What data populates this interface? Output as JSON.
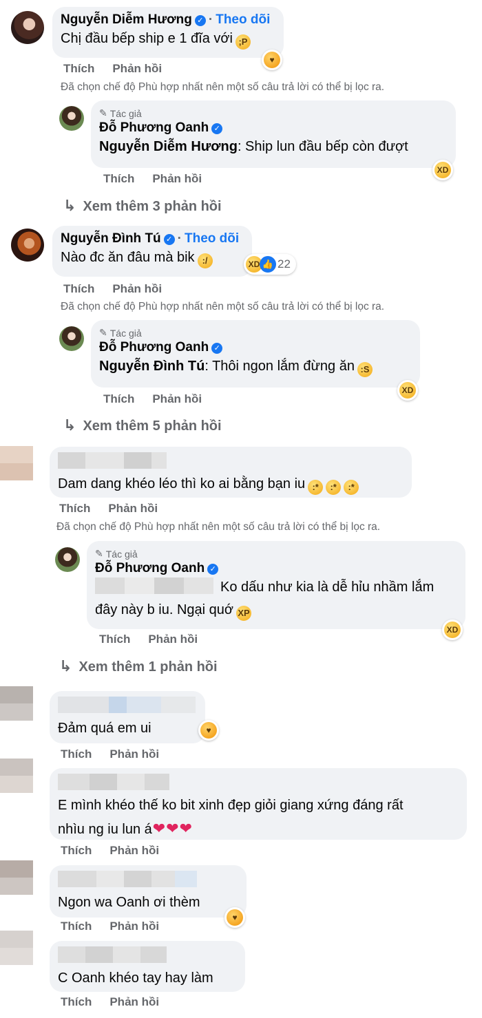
{
  "labels": {
    "like": "Thích",
    "reply": "Phản hồi",
    "follow": "Theo dõi",
    "author_badge": "Tác giả",
    "filter_note": "Đã chọn chế độ Phù hợp nhất nên một số câu trả lời có thể bị lọc ra."
  },
  "threads": [
    {
      "name": "Nguyễn Diễm Hương",
      "text": "Chị đầu bếp ship e 1 đĩa với",
      "reply": {
        "name": "Đỗ Phương Oanh",
        "mention": "Nguyễn Diễm Hương",
        "text": ": Ship lun đầu bếp còn đượt"
      },
      "more_replies": "Xem thêm 3 phản hồi"
    },
    {
      "name": "Nguyễn Đình Tú",
      "text": "Nào đc ăn đâu mà bik",
      "reaction_count": "22",
      "reply": {
        "name": "Đỗ Phương Oanh",
        "mention": "Nguyễn Đình Tú",
        "text": ": Thôi ngon lắm đừng ăn"
      },
      "more_replies": "Xem thêm 5 phản hồi"
    },
    {
      "text": "Dam dang khéo léo thì ko ai bằng bạn iu",
      "reply": {
        "name": "Đỗ Phương Oanh",
        "text_line1": "Ko dấu như kia là dễ hỉu nhầm lắm",
        "text_line2": "đây này b iu. Ngại quớ"
      },
      "more_replies": "Xem thêm 1 phản hồi"
    }
  ],
  "comments": [
    {
      "text": "Đảm quá em ui"
    },
    {
      "text_line1": "E mình khéo thế ko bit xinh đẹp giỏi giang xứng đáng rất",
      "text_line2": "nhìu ng iu lun á"
    },
    {
      "text": "Ngon wa Oanh ơi thèm"
    },
    {
      "text": "C Oanh khéo tay hay làm"
    }
  ],
  "colors": {
    "link": "#1877f2",
    "meta": "#65676b",
    "bubble": "#f0f2f5"
  },
  "icons": [
    "verified-badge-icon",
    "pencil-icon",
    "reply-arrow-icon",
    "haha-reaction-icon",
    "care-reaction-icon",
    "like-reaction-icon",
    "heart-icon"
  ]
}
